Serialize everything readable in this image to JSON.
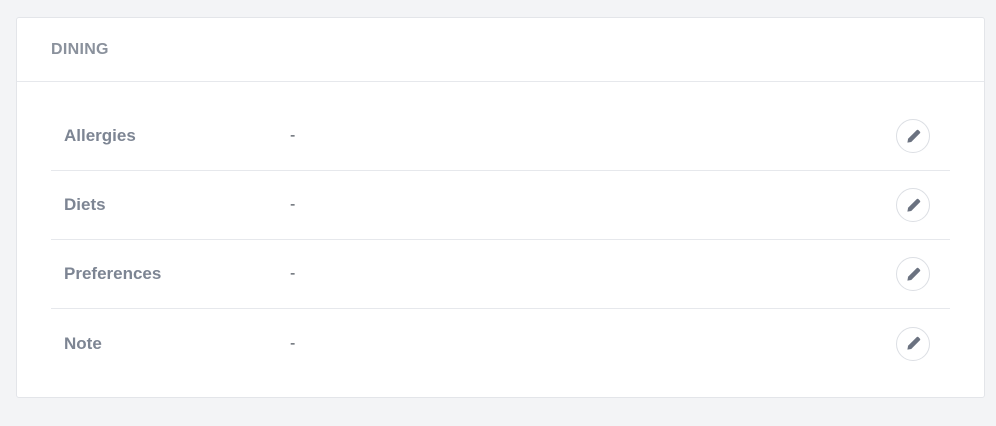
{
  "section": {
    "title": "DINING"
  },
  "fields": [
    {
      "label": "Allergies",
      "value": "-"
    },
    {
      "label": "Diets",
      "value": "-"
    },
    {
      "label": "Preferences",
      "value": "-"
    },
    {
      "label": "Note",
      "value": "-"
    }
  ],
  "icons": {
    "edit": "pencil-icon"
  },
  "colors": {
    "background": "#f3f4f6",
    "card": "#ffffff",
    "label": "#7d8593",
    "title": "#8a919c",
    "icon": "#6b7280"
  }
}
